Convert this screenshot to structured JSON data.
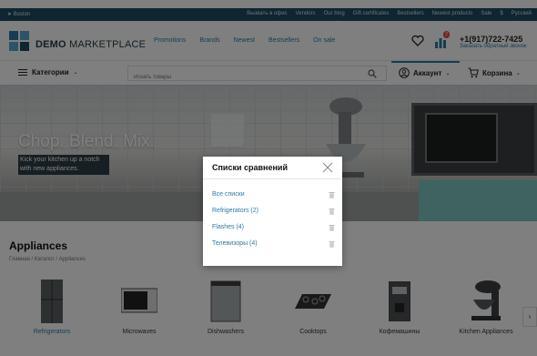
{
  "topbar": {
    "location": "Boston",
    "links": [
      "Вызвать в офис",
      "Vendors",
      "Our blog",
      "Gift certificates",
      "Bestsellers",
      "Newest products",
      "Sale",
      "$",
      "Русский"
    ]
  },
  "header": {
    "logo_demo": "DEMO",
    "logo_market": "MARKETPLACE",
    "nav": [
      "Promotions",
      "Brands",
      "Newest",
      "Bestsellers",
      "On sale"
    ],
    "compare_badge": "2",
    "phone": "+1(917)722-7425",
    "callback": "Заказать обратный звонок"
  },
  "bar": {
    "categories": "Категории",
    "search_placeholder": "Искать товары",
    "account": "Аккаунт",
    "cart": "Корзина"
  },
  "hero": {
    "title": "Chop. Blend. Mix.",
    "subtitle": "Kick your kitchen up a notch with new appliances."
  },
  "section": {
    "title": "Appliances",
    "breadcrumb": "Главная / Каталог / Appliances",
    "products": [
      {
        "label": "Refrigerators",
        "icon": "refrigerator-icon"
      },
      {
        "label": "Microwaves",
        "icon": "microwave-icon"
      },
      {
        "label": "Dishwashers",
        "icon": "dishwasher-icon"
      },
      {
        "label": "Cooktops",
        "icon": "cooktop-icon"
      },
      {
        "label": "Кофемашины",
        "icon": "coffee-machine-icon"
      },
      {
        "label": "Kitchen Appliances",
        "icon": "mixer-icon"
      }
    ]
  },
  "modal": {
    "title": "Списки сравнений",
    "items": [
      {
        "label": "Все списки"
      },
      {
        "label": "Refrigerators  (2)"
      },
      {
        "label": "Flashes  (4)"
      },
      {
        "label": "Телевизоры  (4)"
      }
    ]
  },
  "colors": {
    "topbar": "#1f4b63",
    "link": "#2a7ba7",
    "badge": "#e84b3c"
  }
}
